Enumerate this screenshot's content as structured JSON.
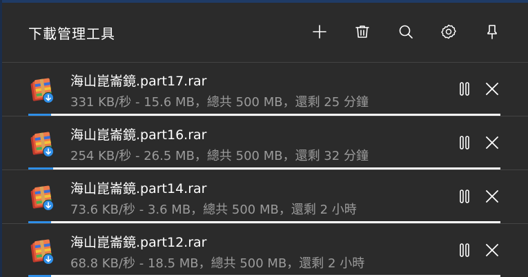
{
  "window": {
    "title": "下載管理工具"
  },
  "header_actions": [
    {
      "name": "add-button",
      "icon": "plus-icon"
    },
    {
      "name": "delete-button",
      "icon": "trash-icon"
    },
    {
      "name": "search-button",
      "icon": "search-icon"
    },
    {
      "name": "settings-button",
      "icon": "gear-icon"
    },
    {
      "name": "pin-button",
      "icon": "pin-icon"
    }
  ],
  "downloads": [
    {
      "name": "海山崑崙鏡.part17.rar",
      "status": "331 KB/秒 - 15.6 MB，總共 500 MB，還剩 25 分鐘",
      "progress": 0.031
    },
    {
      "name": "海山崑崙鏡.part16.rar",
      "status": "254 KB/秒 - 26.5 MB，總共 500 MB，還剩 32 分鐘",
      "progress": 0.053
    },
    {
      "name": "海山崑崙鏡.part14.rar",
      "status": "73.6 KB/秒 - 3.6 MB，總共 500 MB，還剩 2 小時",
      "progress": 0.007
    },
    {
      "name": "海山崑崙鏡.part12.rar",
      "status": "68.8 KB/秒 - 18.5 MB，總共 500 MB，還剩 2 小時",
      "progress": 0.037
    }
  ],
  "colors": {
    "background": "#2b2b2b",
    "progress_track": "#ffffff",
    "progress_fill": "#2f8fe8",
    "text_primary": "#ffffff",
    "text_secondary": "#9b9b9b"
  }
}
